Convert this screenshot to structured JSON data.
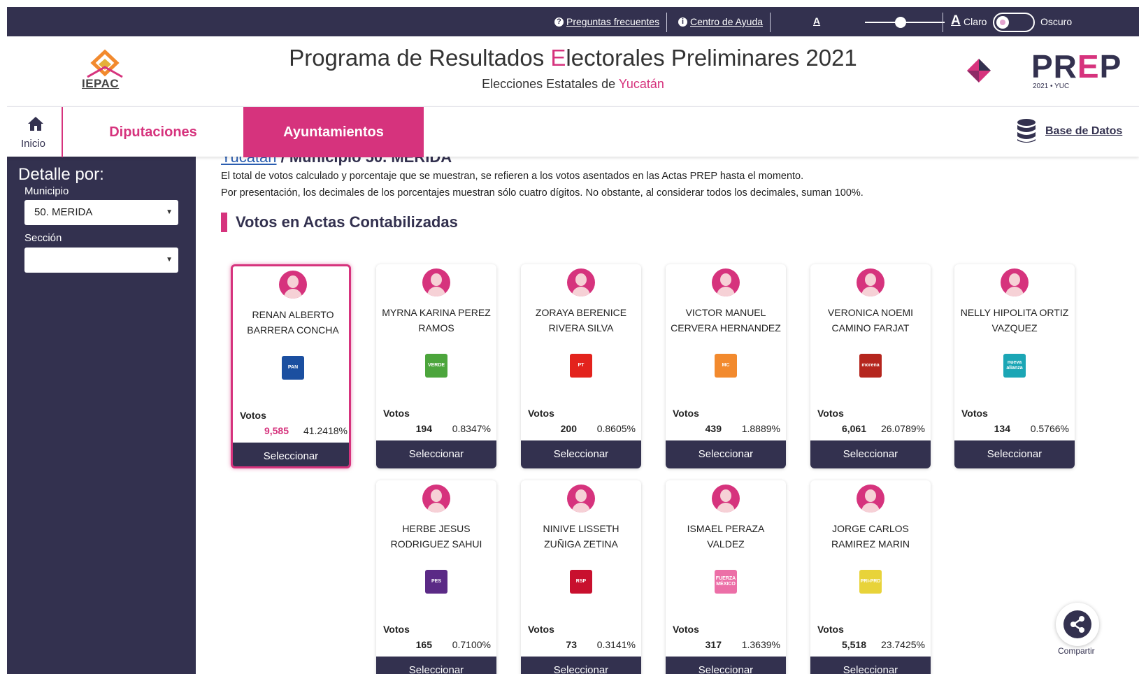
{
  "topbar": {
    "faq": "Preguntas frecuentes",
    "help": "Centro de Ayuda",
    "font_small": "A",
    "font_large": "A",
    "theme_light": "Claro",
    "theme_dark": "Oscuro"
  },
  "header": {
    "org": "IEPAC",
    "title_pre": "Programa de Resultados ",
    "title_E": "E",
    "title_post": "lectorales Preliminares 2021",
    "subtitle_pre": "Elecciones Estatales de ",
    "subtitle_state": "Yucatán",
    "brand_pre": "PR",
    "brand_e": "E",
    "brand_post": "P",
    "brand_sub": "2021 • YUC"
  },
  "nav": {
    "home": "Inicio",
    "tabs": [
      "Diputaciones",
      "Ayuntamientos"
    ],
    "database": "Base de Datos"
  },
  "sidebar": {
    "title": "Detalle por:",
    "municipio_label": "Municipio",
    "municipio_value": "50. MERIDA",
    "seccion_label": "Sección",
    "seccion_value": ""
  },
  "main": {
    "breadcrumb_link": "Yucatán",
    "breadcrumb_rest": " / Municipio 50. MERIDA",
    "info1": "El total de votos calculado y porcentaje que se muestran, se refieren a los votos asentados en las Actas PREP hasta el momento.",
    "info2": "Por presentación, los decimales de los porcentajes muestran sólo cuatro dígitos. No obstante, al considerar todos los decimales, suman 100%.",
    "section_title": "Votos en Actas Contabilizadas",
    "votes_label": "Votos",
    "select_label": "Seleccionar"
  },
  "candidates": [
    {
      "name": "RENAN ALBERTO BARRERA CONCHA",
      "party": "PAN",
      "party_color": "#1b4fa0",
      "votes": "9,585",
      "pct": "41.2418%",
      "selected": true
    },
    {
      "name": "MYRNA KARINA PEREZ RAMOS",
      "party": "VERDE",
      "party_color": "#4ca53c",
      "votes": "194",
      "pct": "0.8347%"
    },
    {
      "name": "ZORAYA BERENICE RIVERA SILVA",
      "party": "PT",
      "party_color": "#e3231d",
      "votes": "200",
      "pct": "0.8605%"
    },
    {
      "name": "VICTOR MANUEL CERVERA HERNANDEZ",
      "party": "MC",
      "party_color": "#f28a2e",
      "votes": "439",
      "pct": "1.8889%"
    },
    {
      "name": "VERONICA NOEMI CAMINO FARJAT",
      "party": "morena",
      "party_color": "#b5261e",
      "votes": "6,061",
      "pct": "26.0789%"
    },
    {
      "name": "NELLY HIPOLITA ORTIZ VAZQUEZ",
      "party": "nueva alianza",
      "party_color": "#1ba6b5",
      "votes": "134",
      "pct": "0.5766%"
    },
    {
      "name": "HERBE JESUS RODRIGUEZ SAHUI",
      "party": "PES",
      "party_color": "#5b2a86",
      "votes": "165",
      "pct": "0.7100%"
    },
    {
      "name": "NINIVE LISSETH ZUÑIGA ZETINA",
      "party": "RSP",
      "party_color": "#c8102e",
      "votes": "73",
      "pct": "0.3141%"
    },
    {
      "name": "ISMAEL PERAZA VALDEZ",
      "party": "FUERZA MÉXICO",
      "party_color": "#ec6fa7",
      "votes": "317",
      "pct": "1.3639%"
    },
    {
      "name": "JORGE CARLOS RAMIREZ MARIN",
      "party": "PRI-PRD",
      "party_color": "#e8d33a",
      "votes": "5,518",
      "pct": "23.7425%"
    }
  ],
  "share": "Compartir"
}
